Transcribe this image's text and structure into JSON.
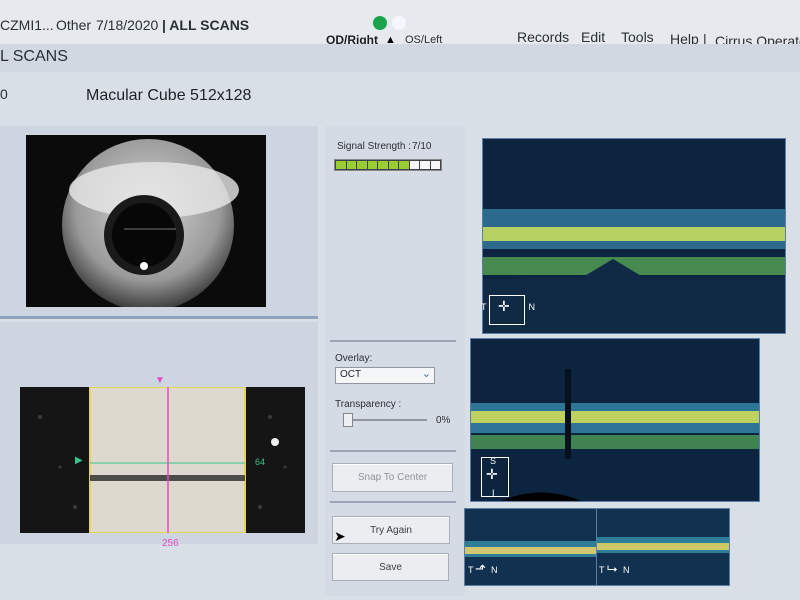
{
  "header": {
    "device": "CZMI1...",
    "eye_type": "Other",
    "date": "7/18/2020",
    "section": "| ALL SCANS",
    "od_label": "OD/Right",
    "os_label": "OS/Left",
    "operator_tail": "Cirrus Operato"
  },
  "menu": {
    "records": "Records",
    "edit": "Edit",
    "tools": "Tools",
    "help": "Help",
    "separator": "|"
  },
  "subheader": {
    "title_fragment": "L SCANS"
  },
  "scan": {
    "title": "Macular Cube 512x128",
    "left_fragment": "0"
  },
  "signal": {
    "label": "Signal Strength :",
    "value_text": "7/10",
    "value": 7,
    "max": 10,
    "colors": {
      "filled": "#9acd32",
      "empty": "#f7f7f7"
    }
  },
  "overlay": {
    "label": "Overlay:",
    "selected": "OCT"
  },
  "transparency": {
    "label": "Transparency :",
    "value_text": "0%",
    "value": 0
  },
  "buttons": {
    "snap": "Snap To Center",
    "try_again": "Try Again",
    "save": "Save"
  },
  "fundus": {
    "bottom_marker": "256",
    "right_marker": "64"
  },
  "orientation": {
    "t": "T",
    "n": "N",
    "s": "S",
    "i": "I"
  },
  "colors": {
    "accent_pink": "#e64ac0",
    "accent_green": "#35c489",
    "frame_yellow": "#e6d34e",
    "status_green": "#1aa34a"
  }
}
